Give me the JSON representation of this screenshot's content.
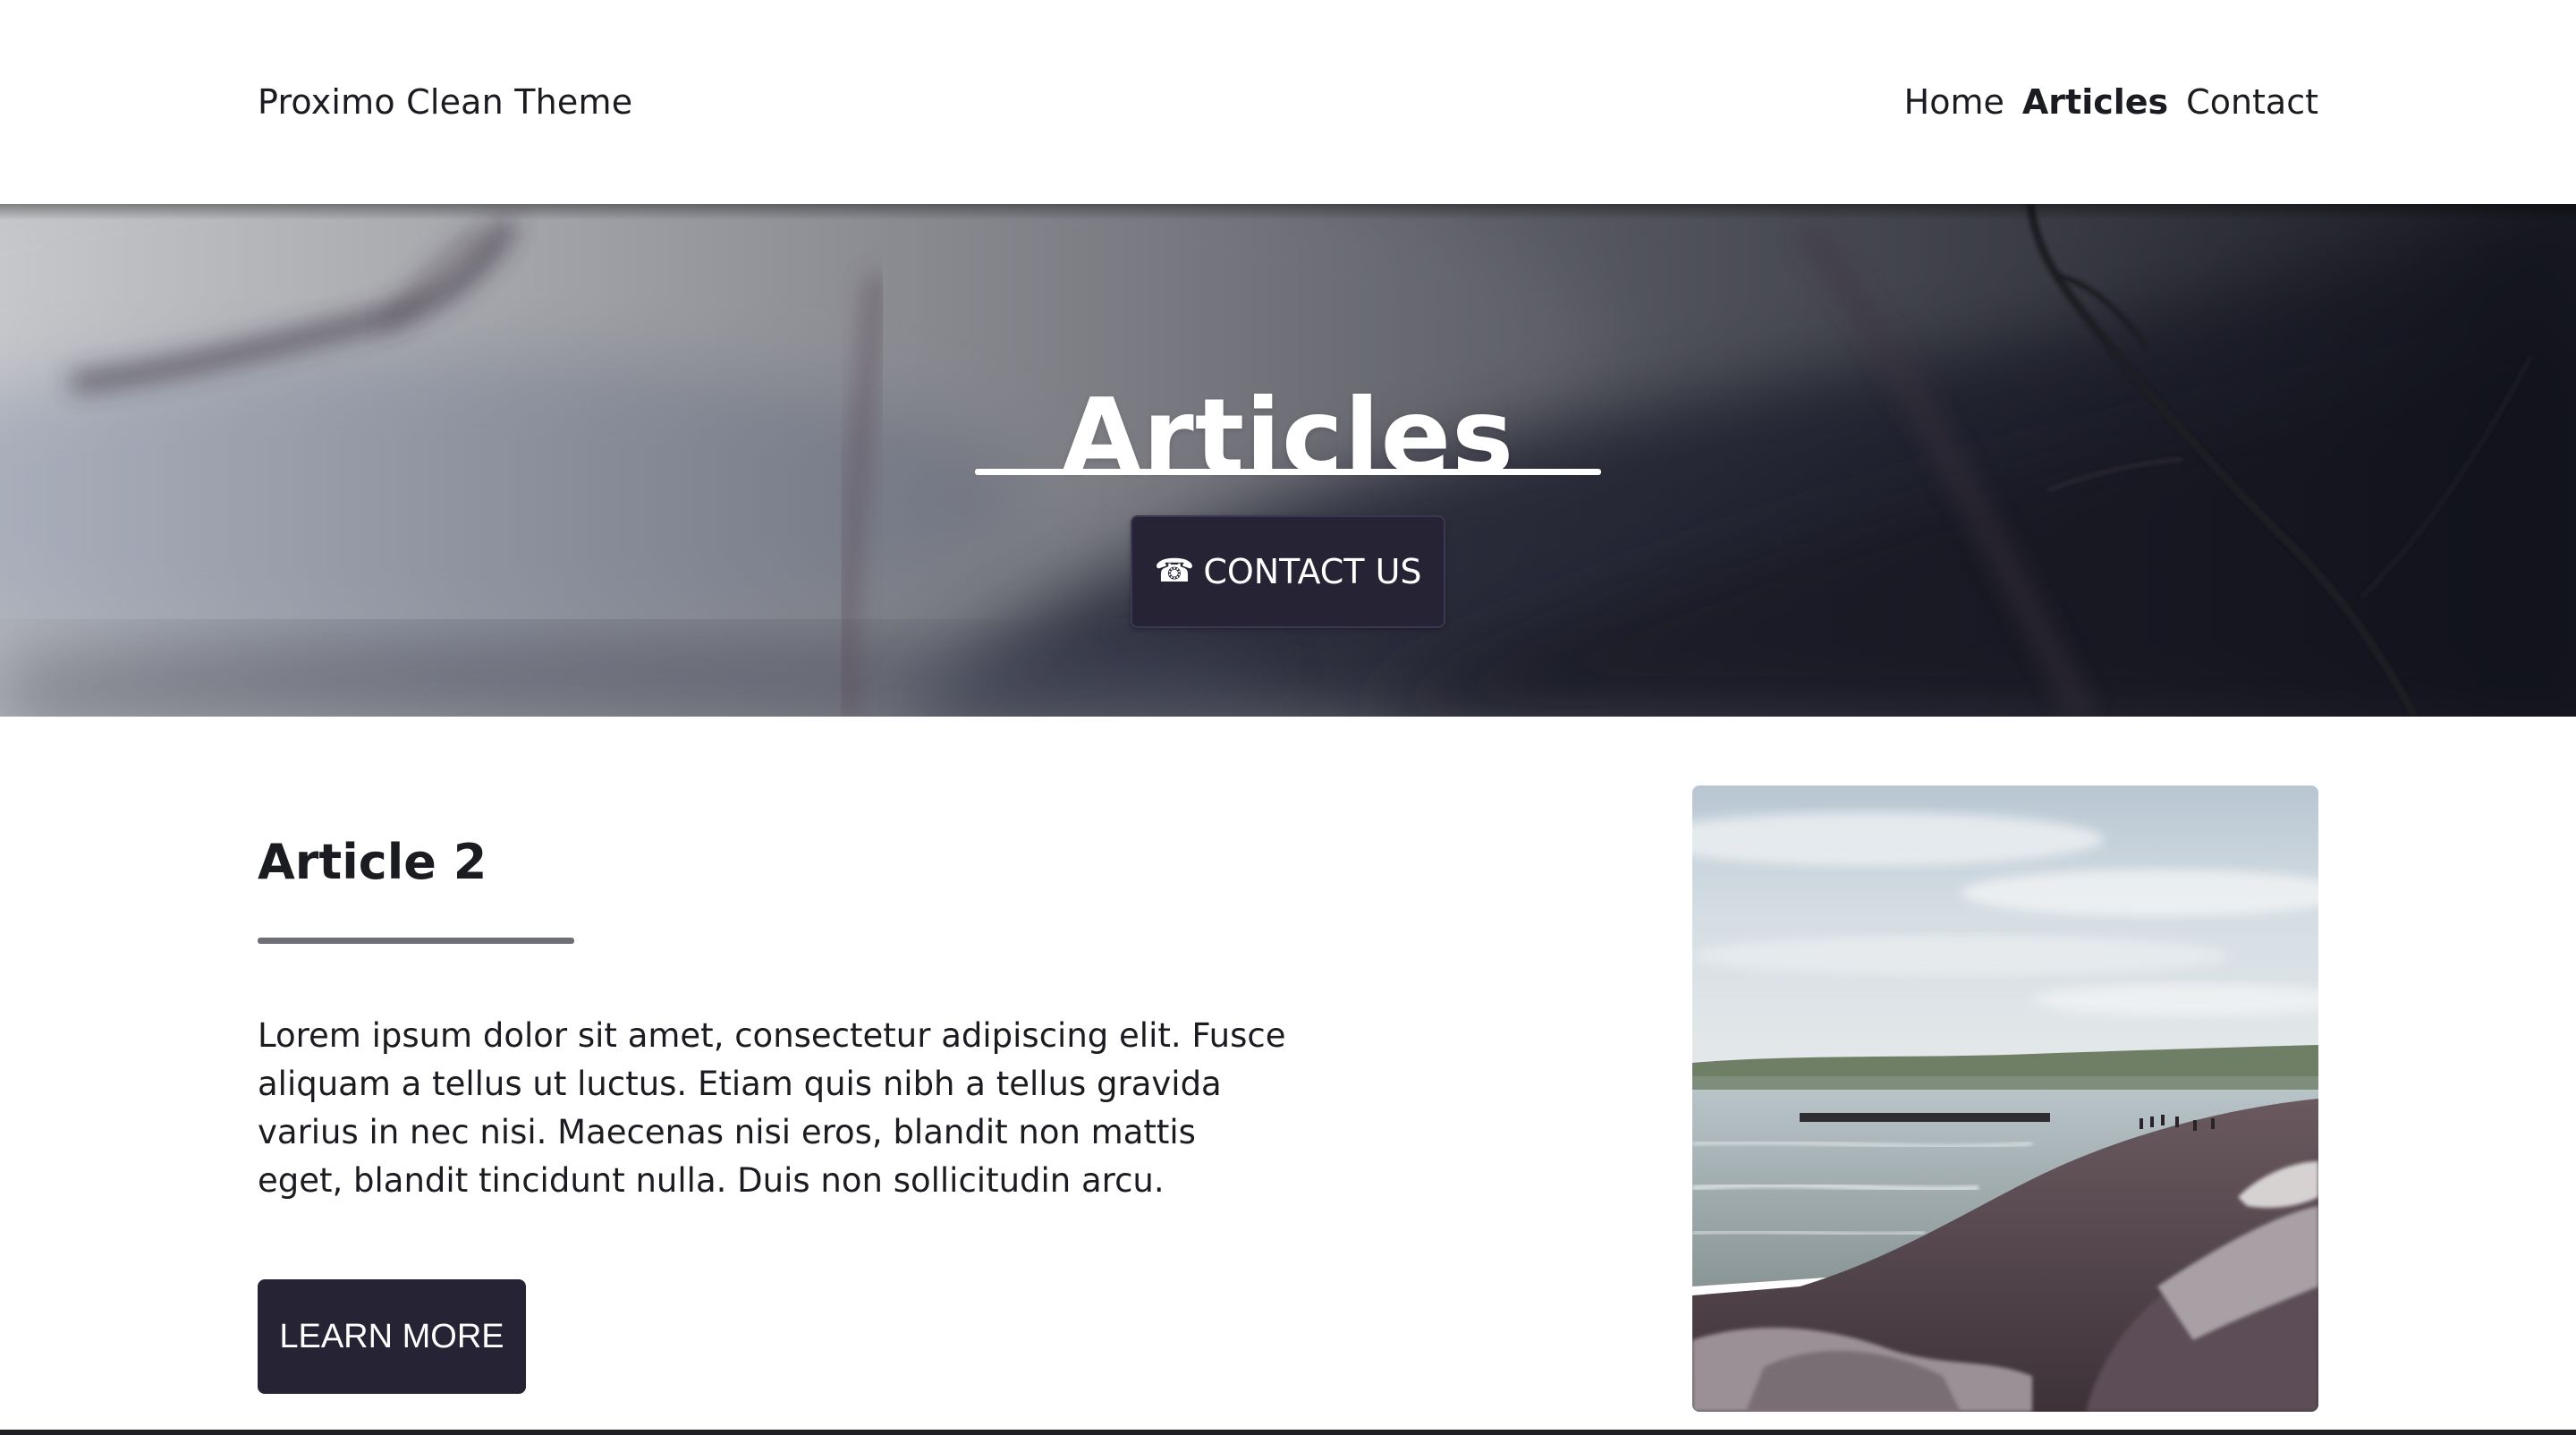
{
  "header": {
    "brand": "Proximo Clean Theme",
    "nav": [
      {
        "label": "Home",
        "active": false
      },
      {
        "label": "Articles",
        "active": true
      },
      {
        "label": "Contact",
        "active": false
      }
    ]
  },
  "hero": {
    "title": "Articles",
    "contact_button": {
      "icon": "phone-icon",
      "icon_glyph": "☎",
      "label": "CONTACT US"
    }
  },
  "article": {
    "title": "Article 2",
    "body": "Lorem ipsum dolor sit amet, consectetur adipiscing elit. Fusce aliquam a tellus ut luctus. Etiam quis nibh a tellus gravida varius in nec nisi. Maecenas nisi eros, blandit non mattis eget, blandit tincidunt nulla. Duis non sollicitudin arcu.",
    "button_label": "LEARN MORE"
  },
  "colors": {
    "button_bg": "#252334",
    "text": "#1b1b22",
    "rule_gray": "#6e6e78"
  }
}
